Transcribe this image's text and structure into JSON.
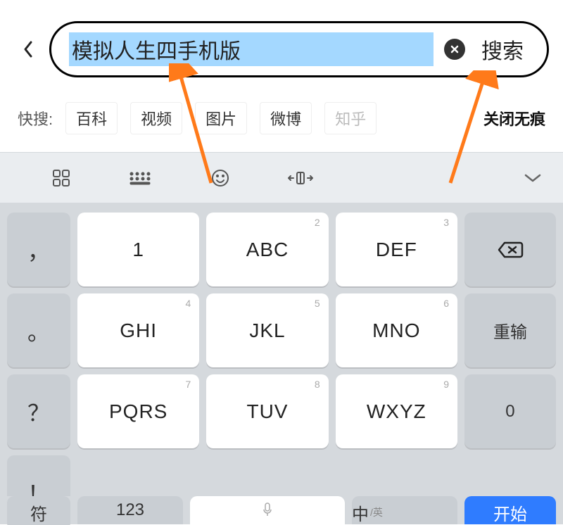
{
  "header": {
    "search_text": "模拟人生四手机版",
    "search_button": "搜索"
  },
  "quick": {
    "label": "快搜:",
    "items": [
      "百科",
      "视频",
      "图片",
      "微博",
      "知乎"
    ],
    "close_incognito": "关闭无痕"
  },
  "keyboard": {
    "punct": [
      "，",
      "。",
      "？",
      "！"
    ],
    "rows": [
      {
        "num": "1",
        "main": "1"
      },
      {
        "num": "2",
        "main": "ABC"
      },
      {
        "num": "3",
        "main": "DEF"
      },
      {
        "num": "4",
        "main": "GHI"
      },
      {
        "num": "5",
        "main": "JKL"
      },
      {
        "num": "6",
        "main": "MNO"
      },
      {
        "num": "7",
        "main": "PQRS"
      },
      {
        "num": "8",
        "main": "TUV"
      },
      {
        "num": "9",
        "main": "WXYZ"
      }
    ],
    "retype": "重输",
    "zero": "0",
    "symbol": "符",
    "num123": "123",
    "lang": "中",
    "lang_sub": "/英",
    "start": "开始"
  }
}
